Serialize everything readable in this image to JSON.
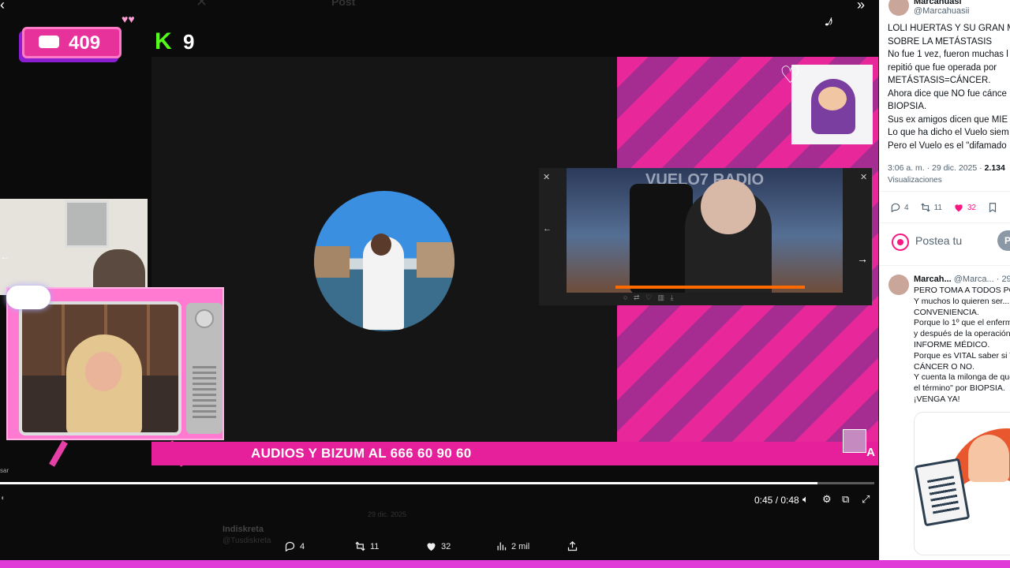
{
  "video": {
    "ghost_title": "Post",
    "counter_value": "409",
    "k_badge": "K",
    "k_value": "9",
    "banner_text": "AUDIOS Y BIZUM AL 666 60 90 60",
    "banner_tail": "A",
    "studio_title": "VUELO7 RADIO",
    "side_label": "sar",
    "progress_fraction": 0.935,
    "time": "0:45 / 0:48"
  },
  "ghost_post": {
    "author": "Indiskreta",
    "handle": "@Tusdiskreta",
    "meta": "29 dic. 2025"
  },
  "actions": {
    "reply_count": "4",
    "repost_count": "11",
    "like_count": "32",
    "view_count": "2 mil"
  },
  "panel": {
    "name": "Marcahuasi",
    "handle": "@Marcahuasii",
    "lines": [
      "LOLI HUERTAS Y SU GRAN M",
      "SOBRE LA METÁSTASIS",
      "No fue 1 vez, fueron muchas l",
      "repitió que fue operada por",
      "METÁSTASIS=CÁNCER.",
      "Ahora dice que NO fue cánce",
      "BIOPSIA.",
      "Sus ex amigos dicen que MIE",
      "Lo que ha dicho el Vuelo siem",
      "Pero el Vuelo es el \"difamado"
    ],
    "time": "3:06 a. m. · 29 dic. 2025 ·",
    "views_value": "2.134",
    "views_label": "Visualizaciones",
    "replies": "4",
    "reposts": "11",
    "likes": "32",
    "reply_placeholder": "Postea tu",
    "reply_button": "P",
    "comment": {
      "name": "Marcah...",
      "handle": "@Marca...",
      "date": "· 29",
      "lines": [
        "PERO TOMA A TODOS PO",
        "Y muchos lo quieren ser...",
        "CONVENIENCIA.",
        "Porque lo 1º que el enferm",
        "y después de la operación",
        "INFORME MÉDICO.",
        "Porque es VITAL saber si T",
        "CÁNCER O NO.",
        "Y cuenta la milonga de que",
        "el término\" por BIOPSIA.",
        "¡VENGA YA!"
      ]
    }
  },
  "colors": {
    "pink": "#e5209a",
    "like_pink": "#f91880",
    "bottom_bar": "#e03bd9"
  }
}
